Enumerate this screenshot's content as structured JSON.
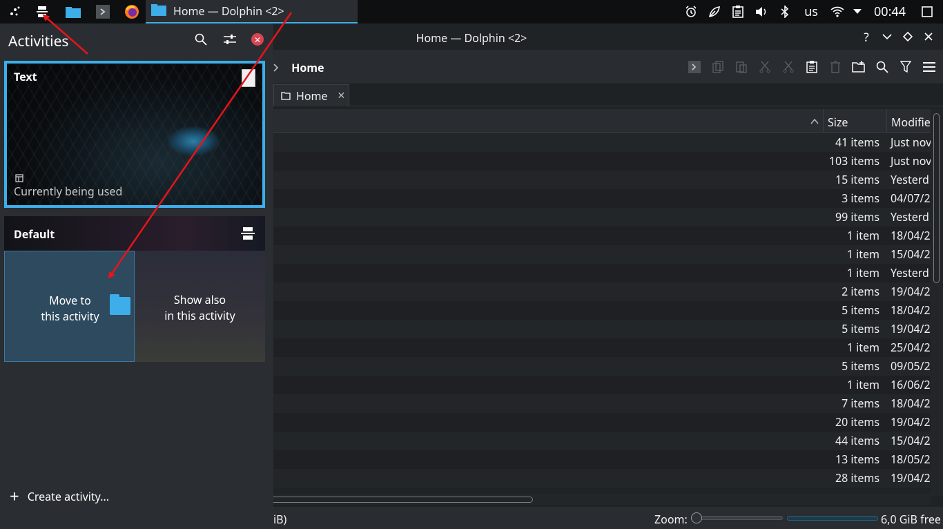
{
  "panel": {
    "task_title": "Home — Dolphin <2>",
    "keyboard_layout": "us",
    "clock": "00:44"
  },
  "window": {
    "title": "Home — Dolphin <2>",
    "help": "?",
    "breadcrumb": "Home",
    "tab_label": "Home",
    "columns": {
      "size": "Size",
      "modified": "Modifie"
    },
    "rows": [
      {
        "size": "41 items",
        "modified": "Just nov"
      },
      {
        "size": "103 items",
        "modified": "Just nov"
      },
      {
        "size": "15 items",
        "modified": "Yesterd"
      },
      {
        "size": "3 items",
        "modified": "04/07/2"
      },
      {
        "size": "99 items",
        "modified": "Yesterd"
      },
      {
        "size": "1 item",
        "modified": "18/04/2"
      },
      {
        "size": "1 item",
        "modified": "15/04/2"
      },
      {
        "size": "1 item",
        "modified": "Yesterd"
      },
      {
        "size": "2 items",
        "modified": "19/04/2"
      },
      {
        "size": "5 items",
        "modified": "18/04/2"
      },
      {
        "size": "5 items",
        "modified": "19/04/2"
      },
      {
        "size": "1 item",
        "modified": "25/04/2"
      },
      {
        "size": "5 items",
        "modified": "09/05/2"
      },
      {
        "size": "1 item",
        "modified": "16/06/2"
      },
      {
        "size": "7 items",
        "modified": "18/04/2"
      },
      {
        "size": "20 items",
        "modified": "19/04/2"
      },
      {
        "size": "44 items",
        "modified": "15/04/2"
      },
      {
        "size": "13 items",
        "modified": "18/05/2"
      },
      {
        "size": "28 items",
        "modified": "19/04/2"
      }
    ],
    "status_left": "iB)",
    "zoom_label": "Zoom:",
    "free_space": "6,0 GiB free"
  },
  "activities": {
    "heading": "Activities",
    "current": {
      "name": "Text",
      "state": "Currently being used"
    },
    "other": {
      "name": "Default",
      "move_label": [
        "Move to",
        "this activity"
      ],
      "show_label": [
        "Show also",
        "in this activity"
      ]
    },
    "create_label": "Create activity..."
  },
  "colors": {
    "accent": "#3daee9",
    "annotation": "#e8141a",
    "close": "#da4453"
  }
}
